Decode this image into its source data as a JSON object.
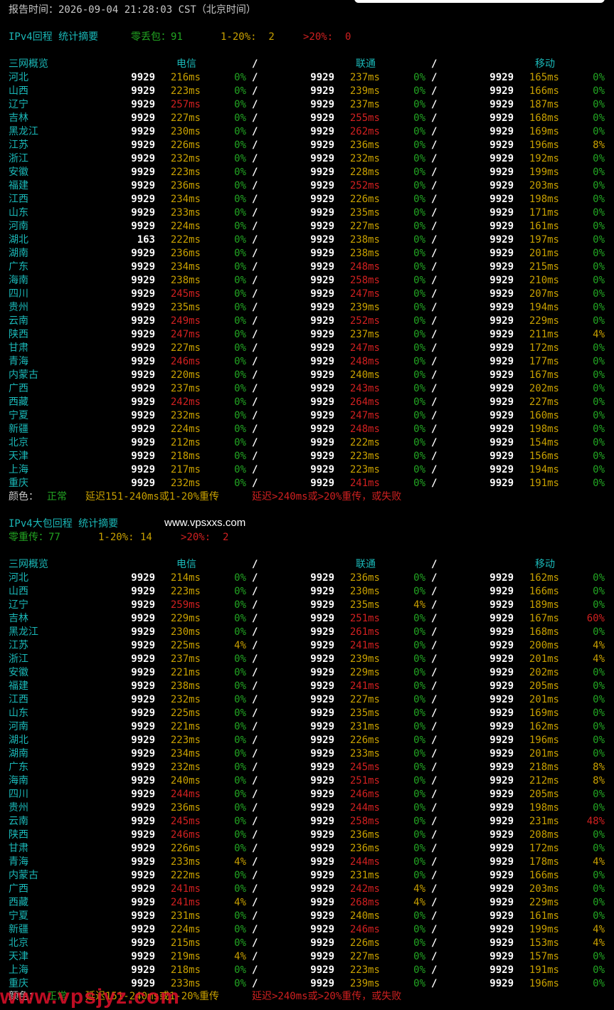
{
  "header": {
    "report_time": "报告时间：2026-09-04 21:28:03 CST（北京时间）"
  },
  "section1": {
    "title": "IPv4回程 统计摘要",
    "summary": {
      "zero_label": "零丢包：91",
      "mid_label": "1-20%:  2",
      "high_label": ">20%:  0"
    }
  },
  "section2": {
    "title": "IPv4大包回程 统计摘要",
    "summary": {
      "zero_label": "零重传：77",
      "mid_label": "1-20%: 14",
      "high_label": ">20%:  2"
    }
  },
  "table_header": {
    "overview": "三网概览",
    "telecom": "电信",
    "unicom": "联通",
    "mobile": "移动",
    "sep": "/"
  },
  "legend": {
    "label": "颜色：",
    "normal": "正常",
    "warn": "延迟151-240ms或1-20%重传",
    "bad": "延迟>240ms或>20%重传，或失败"
  },
  "watermarks": {
    "site1": "www.vpsxxs.com",
    "site2": "www.vpsjyz.com"
  },
  "colors": {
    "bg": "#000000",
    "cyan": "#1ab8b8",
    "green": "#22a522",
    "yellow": "#c8a000",
    "red": "#d02020"
  },
  "table1": [
    [
      "河北",
      "9929",
      "216ms",
      "0%",
      "9929",
      "237ms",
      "0%",
      "9929",
      "165ms",
      "0%"
    ],
    [
      "山西",
      "9929",
      "223ms",
      "0%",
      "9929",
      "239ms",
      "0%",
      "9929",
      "166ms",
      "0%"
    ],
    [
      "辽宁",
      "9929",
      "257ms",
      "0%",
      "9929",
      "237ms",
      "0%",
      "9929",
      "187ms",
      "0%"
    ],
    [
      "吉林",
      "9929",
      "227ms",
      "0%",
      "9929",
      "255ms",
      "0%",
      "9929",
      "168ms",
      "0%"
    ],
    [
      "黑龙江",
      "9929",
      "230ms",
      "0%",
      "9929",
      "262ms",
      "0%",
      "9929",
      "169ms",
      "0%"
    ],
    [
      "江苏",
      "9929",
      "226ms",
      "0%",
      "9929",
      "236ms",
      "0%",
      "9929",
      "196ms",
      "8%"
    ],
    [
      "浙江",
      "9929",
      "232ms",
      "0%",
      "9929",
      "232ms",
      "0%",
      "9929",
      "192ms",
      "0%"
    ],
    [
      "安徽",
      "9929",
      "223ms",
      "0%",
      "9929",
      "228ms",
      "0%",
      "9929",
      "199ms",
      "0%"
    ],
    [
      "福建",
      "9929",
      "236ms",
      "0%",
      "9929",
      "252ms",
      "0%",
      "9929",
      "203ms",
      "0%"
    ],
    [
      "江西",
      "9929",
      "234ms",
      "0%",
      "9929",
      "226ms",
      "0%",
      "9929",
      "198ms",
      "0%"
    ],
    [
      "山东",
      "9929",
      "233ms",
      "0%",
      "9929",
      "235ms",
      "0%",
      "9929",
      "171ms",
      "0%"
    ],
    [
      "河南",
      "9929",
      "224ms",
      "0%",
      "9929",
      "227ms",
      "0%",
      "9929",
      "161ms",
      "0%"
    ],
    [
      "湖北",
      "163",
      "222ms",
      "0%",
      "9929",
      "238ms",
      "0%",
      "9929",
      "197ms",
      "0%"
    ],
    [
      "湖南",
      "9929",
      "236ms",
      "0%",
      "9929",
      "238ms",
      "0%",
      "9929",
      "201ms",
      "0%"
    ],
    [
      "广东",
      "9929",
      "234ms",
      "0%",
      "9929",
      "248ms",
      "0%",
      "9929",
      "215ms",
      "0%"
    ],
    [
      "海南",
      "9929",
      "238ms",
      "0%",
      "9929",
      "258ms",
      "0%",
      "9929",
      "210ms",
      "0%"
    ],
    [
      "四川",
      "9929",
      "245ms",
      "0%",
      "9929",
      "247ms",
      "0%",
      "9929",
      "207ms",
      "0%"
    ],
    [
      "贵州",
      "9929",
      "235ms",
      "0%",
      "9929",
      "239ms",
      "0%",
      "9929",
      "194ms",
      "0%"
    ],
    [
      "云南",
      "9929",
      "249ms",
      "0%",
      "9929",
      "252ms",
      "0%",
      "9929",
      "229ms",
      "0%"
    ],
    [
      "陕西",
      "9929",
      "247ms",
      "0%",
      "9929",
      "237ms",
      "0%",
      "9929",
      "211ms",
      "4%"
    ],
    [
      "甘肃",
      "9929",
      "227ms",
      "0%",
      "9929",
      "247ms",
      "0%",
      "9929",
      "172ms",
      "0%"
    ],
    [
      "青海",
      "9929",
      "246ms",
      "0%",
      "9929",
      "248ms",
      "0%",
      "9929",
      "177ms",
      "0%"
    ],
    [
      "内蒙古",
      "9929",
      "220ms",
      "0%",
      "9929",
      "240ms",
      "0%",
      "9929",
      "167ms",
      "0%"
    ],
    [
      "广西",
      "9929",
      "237ms",
      "0%",
      "9929",
      "243ms",
      "0%",
      "9929",
      "202ms",
      "0%"
    ],
    [
      "西藏",
      "9929",
      "242ms",
      "0%",
      "9929",
      "264ms",
      "0%",
      "9929",
      "227ms",
      "0%"
    ],
    [
      "宁夏",
      "9929",
      "232ms",
      "0%",
      "9929",
      "247ms",
      "0%",
      "9929",
      "160ms",
      "0%"
    ],
    [
      "新疆",
      "9929",
      "224ms",
      "0%",
      "9929",
      "248ms",
      "0%",
      "9929",
      "198ms",
      "0%"
    ],
    [
      "北京",
      "9929",
      "212ms",
      "0%",
      "9929",
      "222ms",
      "0%",
      "9929",
      "154ms",
      "0%"
    ],
    [
      "天津",
      "9929",
      "218ms",
      "0%",
      "9929",
      "223ms",
      "0%",
      "9929",
      "156ms",
      "0%"
    ],
    [
      "上海",
      "9929",
      "217ms",
      "0%",
      "9929",
      "223ms",
      "0%",
      "9929",
      "194ms",
      "0%"
    ],
    [
      "重庆",
      "9929",
      "232ms",
      "0%",
      "9929",
      "241ms",
      "0%",
      "9929",
      "191ms",
      "0%"
    ]
  ],
  "table2": [
    [
      "河北",
      "9929",
      "214ms",
      "0%",
      "9929",
      "236ms",
      "0%",
      "9929",
      "162ms",
      "0%"
    ],
    [
      "山西",
      "9929",
      "223ms",
      "0%",
      "9929",
      "230ms",
      "0%",
      "9929",
      "166ms",
      "0%"
    ],
    [
      "辽宁",
      "9929",
      "259ms",
      "0%",
      "9929",
      "235ms",
      "4%",
      "9929",
      "189ms",
      "0%"
    ],
    [
      "吉林",
      "9929",
      "229ms",
      "0%",
      "9929",
      "251ms",
      "0%",
      "9929",
      "167ms",
      "60%"
    ],
    [
      "黑龙江",
      "9929",
      "230ms",
      "0%",
      "9929",
      "261ms",
      "0%",
      "9929",
      "168ms",
      "0%"
    ],
    [
      "江苏",
      "9929",
      "225ms",
      "4%",
      "9929",
      "241ms",
      "0%",
      "9929",
      "200ms",
      "4%"
    ],
    [
      "浙江",
      "9929",
      "237ms",
      "0%",
      "9929",
      "239ms",
      "0%",
      "9929",
      "201ms",
      "4%"
    ],
    [
      "安徽",
      "9929",
      "221ms",
      "0%",
      "9929",
      "229ms",
      "0%",
      "9929",
      "202ms",
      "0%"
    ],
    [
      "福建",
      "9929",
      "238ms",
      "0%",
      "9929",
      "241ms",
      "0%",
      "9929",
      "205ms",
      "0%"
    ],
    [
      "江西",
      "9929",
      "232ms",
      "0%",
      "9929",
      "227ms",
      "0%",
      "9929",
      "201ms",
      "0%"
    ],
    [
      "山东",
      "9929",
      "225ms",
      "0%",
      "9929",
      "235ms",
      "0%",
      "9929",
      "169ms",
      "0%"
    ],
    [
      "河南",
      "9929",
      "221ms",
      "0%",
      "9929",
      "231ms",
      "0%",
      "9929",
      "162ms",
      "0%"
    ],
    [
      "湖北",
      "9929",
      "223ms",
      "0%",
      "9929",
      "226ms",
      "0%",
      "9929",
      "196ms",
      "0%"
    ],
    [
      "湖南",
      "9929",
      "234ms",
      "0%",
      "9929",
      "233ms",
      "0%",
      "9929",
      "201ms",
      "0%"
    ],
    [
      "广东",
      "9929",
      "232ms",
      "0%",
      "9929",
      "245ms",
      "0%",
      "9929",
      "218ms",
      "8%"
    ],
    [
      "海南",
      "9929",
      "240ms",
      "0%",
      "9929",
      "251ms",
      "0%",
      "9929",
      "212ms",
      "8%"
    ],
    [
      "四川",
      "9929",
      "244ms",
      "0%",
      "9929",
      "246ms",
      "0%",
      "9929",
      "205ms",
      "0%"
    ],
    [
      "贵州",
      "9929",
      "236ms",
      "0%",
      "9929",
      "244ms",
      "0%",
      "9929",
      "198ms",
      "0%"
    ],
    [
      "云南",
      "9929",
      "245ms",
      "0%",
      "9929",
      "258ms",
      "0%",
      "9929",
      "231ms",
      "48%"
    ],
    [
      "陕西",
      "9929",
      "246ms",
      "0%",
      "9929",
      "236ms",
      "0%",
      "9929",
      "208ms",
      "0%"
    ],
    [
      "甘肃",
      "9929",
      "226ms",
      "0%",
      "9929",
      "236ms",
      "0%",
      "9929",
      "172ms",
      "0%"
    ],
    [
      "青海",
      "9929",
      "233ms",
      "4%",
      "9929",
      "244ms",
      "0%",
      "9929",
      "178ms",
      "4%"
    ],
    [
      "内蒙古",
      "9929",
      "222ms",
      "0%",
      "9929",
      "231ms",
      "0%",
      "9929",
      "166ms",
      "0%"
    ],
    [
      "广西",
      "9929",
      "241ms",
      "0%",
      "9929",
      "242ms",
      "4%",
      "9929",
      "203ms",
      "0%"
    ],
    [
      "西藏",
      "9929",
      "241ms",
      "4%",
      "9929",
      "268ms",
      "4%",
      "9929",
      "229ms",
      "0%"
    ],
    [
      "宁夏",
      "9929",
      "231ms",
      "0%",
      "9929",
      "240ms",
      "0%",
      "9929",
      "161ms",
      "0%"
    ],
    [
      "新疆",
      "9929",
      "224ms",
      "0%",
      "9929",
      "246ms",
      "0%",
      "9929",
      "199ms",
      "4%"
    ],
    [
      "北京",
      "9929",
      "215ms",
      "0%",
      "9929",
      "226ms",
      "0%",
      "9929",
      "153ms",
      "4%"
    ],
    [
      "天津",
      "9929",
      "219ms",
      "4%",
      "9929",
      "227ms",
      "0%",
      "9929",
      "157ms",
      "0%"
    ],
    [
      "上海",
      "9929",
      "218ms",
      "0%",
      "9929",
      "223ms",
      "0%",
      "9929",
      "191ms",
      "0%"
    ],
    [
      "重庆",
      "9929",
      "233ms",
      "0%",
      "9929",
      "239ms",
      "0%",
      "9929",
      "196ms",
      "0%"
    ]
  ]
}
